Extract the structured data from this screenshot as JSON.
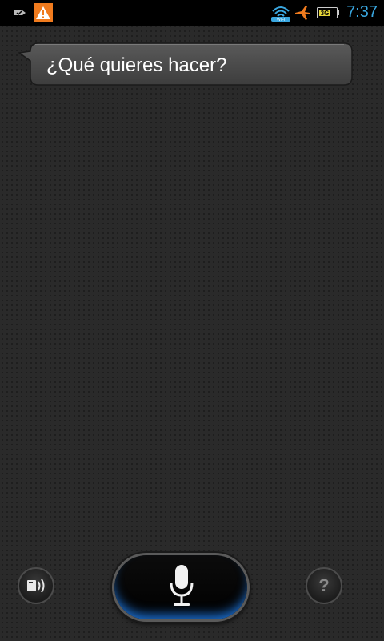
{
  "status_bar": {
    "time": "7:37",
    "icons": [
      "notification-icon",
      "warning-icon",
      "wifi-icon",
      "airplane-icon",
      "battery-icon"
    ],
    "battery_label": "3G",
    "time_color": "#3aa7e0",
    "warning_color": "#f07b1e"
  },
  "prompt": {
    "text": "¿Qué quieres hacer?"
  },
  "controls": {
    "mic_icon": "microphone-icon",
    "speaker_icon": "speaker-icon",
    "help_label": "?",
    "accent_color": "#1c6fd0"
  }
}
